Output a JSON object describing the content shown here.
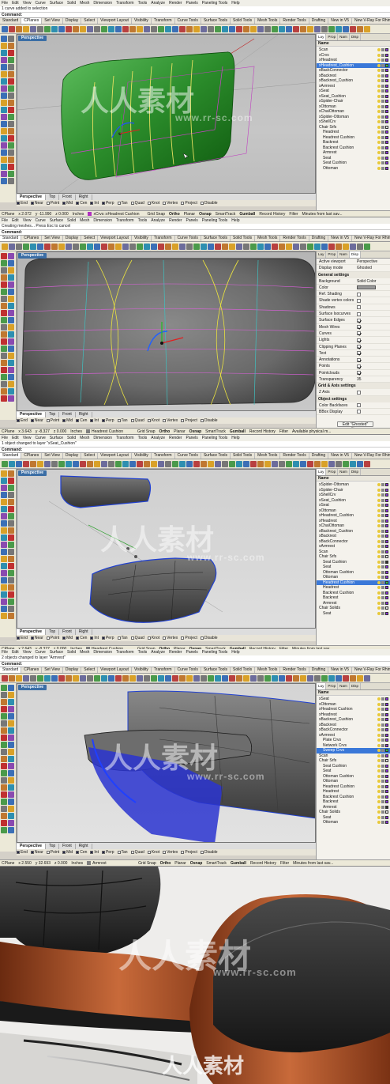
{
  "menu": [
    "File",
    "Edit",
    "View",
    "Curve",
    "Surface",
    "Solid",
    "Mesh",
    "Dimension",
    "Transform",
    "Tools",
    "Analyze",
    "Render",
    "Panels",
    "Paneling Tools",
    "Help"
  ],
  "toolbar_tabs": [
    "Standard",
    "CPlanes",
    "Set View",
    "Display",
    "Select",
    "Viewport Layout",
    "Visibility",
    "Transform",
    "Curve Tools",
    "Surface Tools",
    "Solid Tools",
    "Mesh Tools",
    "Render Tools",
    "Drafting",
    "New in V5",
    "New V-Ray For Rhino",
    "V-Ray Lights 00"
  ],
  "command_label": "Command:",
  "view_tabs": [
    "Perspective",
    "Top",
    "Front",
    "Right"
  ],
  "osnaps": [
    "End",
    "Near",
    "Point",
    "Mid",
    "Cen",
    "Int",
    "Perp",
    "Tan",
    "Quad",
    "Knot",
    "Vertex",
    "Project",
    "Disable"
  ],
  "status_buttons": [
    "Grid Snap",
    "Ortho",
    "Planar",
    "Osnap",
    "SmartTrack",
    "Gumball",
    "Record History",
    "Filter"
  ],
  "watermark": {
    "main": "人人素材",
    "sub": "www.rr-sc.com"
  },
  "screens": [
    {
      "cmd_history": "1 curve added to selection",
      "active_toolbar_tab": "CPlanes",
      "viewport_title": "Perspective",
      "side_tabs": [
        "Lay",
        "Prop",
        "Nam",
        "Disp"
      ],
      "layer_header": "Name",
      "layers": [
        {
          "name": "Scan",
          "sel": false,
          "color": "#8a2be2"
        },
        {
          "name": "xCrvs",
          "sel": false,
          "color": "#8a2be2"
        },
        {
          "name": "xHeadrest",
          "sel": false,
          "color": "#8a2be2"
        },
        {
          "name": "xHeadrest_Cushion",
          "sel": true,
          "color": "#2ecc40"
        },
        {
          "name": "xBackConnector",
          "sel": false,
          "color": "#8a2be2"
        },
        {
          "name": "xBackrest",
          "sel": false,
          "color": "#8a2be2"
        },
        {
          "name": "xBackrest_Cushion",
          "sel": false,
          "color": "#8a2be2"
        },
        {
          "name": "xArmrest",
          "sel": false,
          "color": "#8a2be2"
        },
        {
          "name": "xSeat",
          "sel": false,
          "color": "#8a2be2"
        },
        {
          "name": "xSeat_Cushion",
          "sel": false,
          "color": "#8a2be2"
        },
        {
          "name": "xSpider-Chair",
          "sel": false,
          "color": "#8a2be2"
        },
        {
          "name": "xOttoman",
          "sel": false,
          "color": "#8a2be2"
        },
        {
          "name": "xChaiOttoman",
          "sel": false,
          "color": "#8a2be2"
        },
        {
          "name": "xSpider-Ottoman",
          "sel": false,
          "color": "#8a2be2"
        },
        {
          "name": "xShellCrv",
          "sel": false,
          "color": "#8a2be2"
        },
        {
          "name": "Chair Srfs",
          "sel": false,
          "color": "#e0e0e0"
        },
        {
          "name": "Headrest",
          "sel": false,
          "color": "#8a2be2"
        },
        {
          "name": "Headrest Cushion",
          "sel": false,
          "color": "#8a2be2"
        },
        {
          "name": "Backrest",
          "sel": false,
          "color": "#8a2be2"
        },
        {
          "name": "Backrest Cushion",
          "sel": false,
          "color": "#8a2be2"
        },
        {
          "name": "Armrest",
          "sel": false,
          "color": "#8a2be2"
        },
        {
          "name": "Seat",
          "sel": false,
          "color": "#8a2be2"
        },
        {
          "name": "Seat Cushion",
          "sel": false,
          "color": "#8a2be2"
        },
        {
          "name": "Ottoman",
          "sel": false,
          "color": "#8a2be2"
        }
      ],
      "status": {
        "cplane": "CPlane",
        "x": "x 2.072",
        "y": "y -11.990",
        "z": "z 0.000",
        "units": "Inches",
        "layer": "xCrvs::xHeadrest Cushion",
        "layer_color": "#b030c0",
        "info": "Minutes from last sav..."
      }
    },
    {
      "cmd_history": "Creating meshes... Press Esc to cancel",
      "active_toolbar_tab": "Standard",
      "viewport_title": "Perspective",
      "side_tabs": [
        "Lay",
        "Prop",
        "Nam",
        "Disp"
      ],
      "props": [
        {
          "l": "Active viewport",
          "v": "Perspective",
          "t": "text"
        },
        {
          "l": "Display mode",
          "v": "Ghosted",
          "t": "text"
        },
        {
          "l": "General settings",
          "v": "",
          "t": "sect"
        },
        {
          "l": "Background",
          "v": "Solid Color",
          "t": "text"
        },
        {
          "l": "Color",
          "v": "",
          "t": "swatch"
        },
        {
          "l": "Ref. Shading",
          "v": "",
          "t": "chk0"
        },
        {
          "l": "Shade vertex colors",
          "v": "",
          "t": "chk0"
        },
        {
          "l": "Shadows",
          "v": "",
          "t": "chk0"
        },
        {
          "l": "Surface Isocurves",
          "v": "",
          "t": "chk0"
        },
        {
          "l": "Surface Edges",
          "v": "",
          "t": "chk1"
        },
        {
          "l": "Mesh Wires",
          "v": "",
          "t": "chk1"
        },
        {
          "l": "Curves",
          "v": "",
          "t": "chk1"
        },
        {
          "l": "Lights",
          "v": "",
          "t": "chk1"
        },
        {
          "l": "Clipping Planes",
          "v": "",
          "t": "chk1"
        },
        {
          "l": "Text",
          "v": "",
          "t": "chk1"
        },
        {
          "l": "Annotations",
          "v": "",
          "t": "chk1"
        },
        {
          "l": "Points",
          "v": "",
          "t": "chk1"
        },
        {
          "l": "Pointclouds",
          "v": "",
          "t": "chk1"
        },
        {
          "l": "Transparency",
          "v": "35",
          "t": "text"
        },
        {
          "l": "Grid & Axis settings",
          "v": "",
          "t": "sect"
        },
        {
          "l": "Z Axis",
          "v": "",
          "t": "chk0"
        },
        {
          "l": "Object settings",
          "v": "",
          "t": "sect"
        },
        {
          "l": "Color Backfaces",
          "v": "",
          "t": "chk0"
        },
        {
          "l": "BBox Display",
          "v": "",
          "t": "chk0"
        }
      ],
      "edit_button": "Edit \"Ghosted\" settings...",
      "status": {
        "cplane": "CPlane",
        "x": "x 3.643",
        "y": "y -8.327",
        "z": "z 0.000",
        "units": "Inches",
        "layer": "Headrest Cushion",
        "layer_color": "#808080",
        "info": "Available physical m..."
      }
    },
    {
      "cmd_history": "1 object changed to layer \"xSeat_Cushion\"",
      "active_toolbar_tab": "Standard",
      "viewport_title": "Perspective",
      "side_tabs": [
        "Lay",
        "Prop",
        "Nam",
        "Disp"
      ],
      "layer_header": "Name",
      "layers": [
        {
          "name": "xSpider-Ottoman",
          "sel": false,
          "color": "#8a2be2"
        },
        {
          "name": "xSpider-Chair",
          "sel": false,
          "color": "#8a2be2"
        },
        {
          "name": "xShellCrv",
          "sel": false,
          "color": "#8a2be2"
        },
        {
          "name": "xSeat_Cushion",
          "sel": false,
          "color": "#8a2be2"
        },
        {
          "name": "xSeat",
          "sel": false,
          "color": "#8a2be2"
        },
        {
          "name": "xOttoman",
          "sel": false,
          "color": "#8a2be2"
        },
        {
          "name": "xHeadrest_Cushion",
          "sel": false,
          "color": "#8a2be2"
        },
        {
          "name": "xHeadrest",
          "sel": false,
          "color": "#8a2be2"
        },
        {
          "name": "xChaiOttoman",
          "sel": false,
          "color": "#8a2be2"
        },
        {
          "name": "xBackrest_Cushion",
          "sel": false,
          "color": "#8a2be2"
        },
        {
          "name": "xBackrest",
          "sel": false,
          "color": "#8a2be2"
        },
        {
          "name": "xBackConnector",
          "sel": false,
          "color": "#8a2be2"
        },
        {
          "name": "xArmrest",
          "sel": false,
          "color": "#8a2be2"
        },
        {
          "name": "Scan",
          "sel": false,
          "color": "#8a2be2"
        },
        {
          "name": "Chair Srfs",
          "sel": false,
          "color": "#e0e0e0"
        },
        {
          "name": "Seat Cushion",
          "sel": false,
          "color": "#333333"
        },
        {
          "name": "Seat",
          "sel": false,
          "color": "#8a2be2"
        },
        {
          "name": "Ottoman Cushion",
          "sel": false,
          "color": "#8a2be2"
        },
        {
          "name": "Ottoman",
          "sel": false,
          "color": "#8a2be2"
        },
        {
          "name": "Headrest Cushion",
          "sel": true,
          "color": "#2ecc40"
        },
        {
          "name": "Headrest",
          "sel": false,
          "color": "#8a2be2"
        },
        {
          "name": "Backrest Cushion",
          "sel": false,
          "color": "#8a2be2"
        },
        {
          "name": "Backrest",
          "sel": false,
          "color": "#8a2be2"
        },
        {
          "name": "Armrest",
          "sel": false,
          "color": "#8a2be2"
        },
        {
          "name": "Chair Solids",
          "sel": false,
          "color": "#e0e0e0"
        },
        {
          "name": "Seat",
          "sel": false,
          "color": "#8a2be2"
        }
      ],
      "status": {
        "cplane": "CPlane",
        "x": "x 2.643",
        "y": "y -8.327",
        "z": "z 0.000",
        "units": "Inches",
        "layer": "Headrest Cushion",
        "layer_color": "#808080",
        "info": "Minutes from last sav..."
      }
    },
    {
      "cmd_history": "2 objects changed to layer \"Armrest\"",
      "active_toolbar_tab": "Standard",
      "viewport_title": "Perspective",
      "side_tabs": [
        "Lay",
        "Prop",
        "Nam",
        "Disp"
      ],
      "layer_header": "Name",
      "layers": [
        {
          "name": "xSeat",
          "sel": false,
          "color": "#8a2be2"
        },
        {
          "name": "xOttoman",
          "sel": false,
          "color": "#8a2be2"
        },
        {
          "name": "xHeadrest Cushion",
          "sel": false,
          "color": "#8a2be2"
        },
        {
          "name": "xHeadrest",
          "sel": false,
          "color": "#8a2be2"
        },
        {
          "name": "xBackrest_Cushion",
          "sel": false,
          "color": "#8a2be2"
        },
        {
          "name": "xBackrest",
          "sel": false,
          "color": "#8a2be2"
        },
        {
          "name": "xBackConnector",
          "sel": false,
          "color": "#8a2be2"
        },
        {
          "name": "xArmrest",
          "sel": false,
          "color": "#8a2be2"
        },
        {
          "name": "Plate Crvs",
          "sel": false,
          "color": "#8a2be2"
        },
        {
          "name": "Network Crvs",
          "sel": false,
          "color": "#8a2be2"
        },
        {
          "name": "Sweep Crvs",
          "sel": true,
          "color": "#2ecc40"
        },
        {
          "name": "Scan",
          "sel": false,
          "color": "#8a2be2"
        },
        {
          "name": "Chair Srfs",
          "sel": false,
          "color": "#e0e0e0"
        },
        {
          "name": "Seat Cushion",
          "sel": false,
          "color": "#8a2be2"
        },
        {
          "name": "Seat",
          "sel": false,
          "color": "#8a2be2"
        },
        {
          "name": "Ottoman Cushion",
          "sel": false,
          "color": "#8a2be2"
        },
        {
          "name": "Ottoman",
          "sel": false,
          "color": "#8a2be2"
        },
        {
          "name": "Headrest Cushion",
          "sel": false,
          "color": "#8a2be2"
        },
        {
          "name": "Headrest",
          "sel": false,
          "color": "#8a2be2"
        },
        {
          "name": "Backrest Cushion",
          "sel": false,
          "color": "#8a2be2"
        },
        {
          "name": "Backrest",
          "sel": false,
          "color": "#8a2be2"
        },
        {
          "name": "Armrest",
          "sel": false,
          "color": "#333333"
        },
        {
          "name": "Chair Solids",
          "sel": false,
          "color": "#e0e0e0"
        },
        {
          "name": "Seat",
          "sel": false,
          "color": "#8a2be2"
        },
        {
          "name": "Ottoman",
          "sel": false,
          "color": "#8a2be2"
        }
      ],
      "status": {
        "cplane": "CPlane",
        "x": "x 2.550",
        "y": "y 32.693",
        "z": "z 0.000",
        "units": "Inches",
        "layer": "Armrest",
        "layer_color": "#808080",
        "info": "Minutes from last sav..."
      }
    }
  ]
}
